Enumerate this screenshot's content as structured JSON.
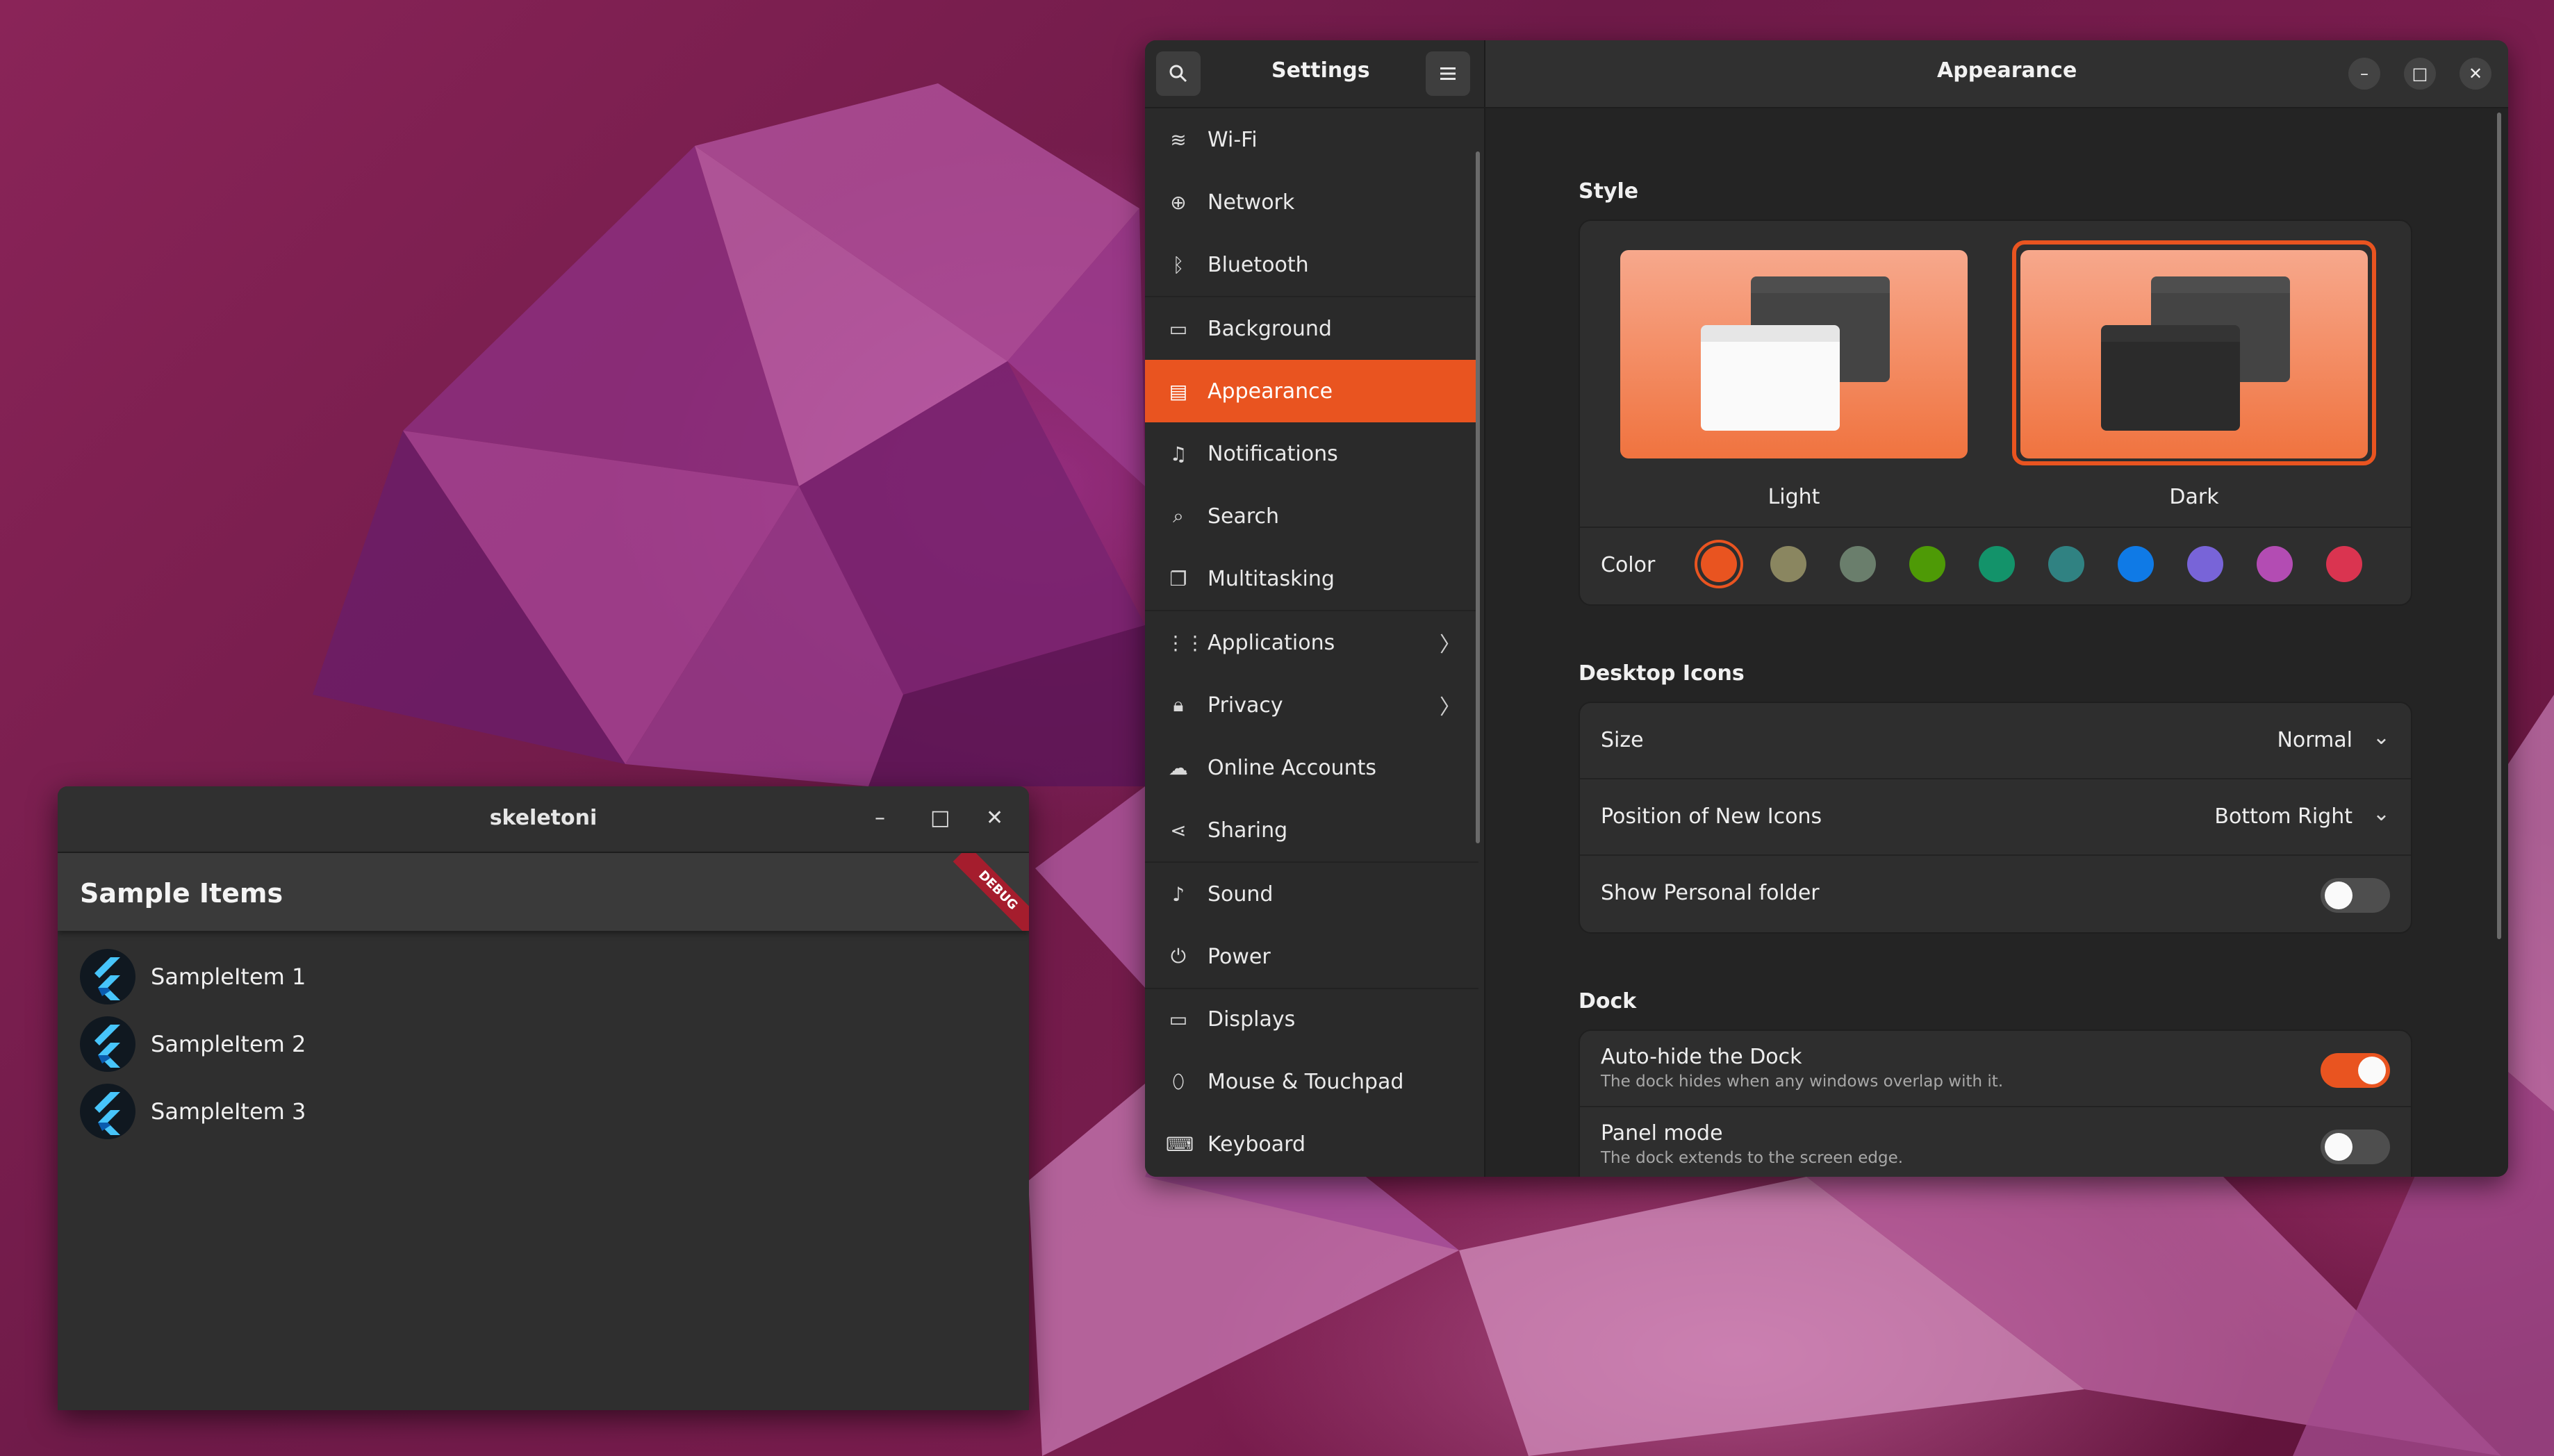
{
  "settings": {
    "header": {
      "app_title": "Settings",
      "page_title": "Appearance",
      "search_icon": "search-icon",
      "menu_icon": "hamburger-menu-icon",
      "minimize": "–",
      "maximize": "□",
      "close": "✕"
    },
    "sidebar": {
      "items": [
        {
          "label": "Wi-Fi",
          "icon": "wifi-icon",
          "glyph": "≋"
        },
        {
          "label": "Network",
          "icon": "network-icon",
          "glyph": "⊕"
        },
        {
          "label": "Bluetooth",
          "icon": "bluetooth-icon",
          "glyph": "ᛒ"
        },
        {
          "label": "Background",
          "icon": "background-icon",
          "glyph": "▭"
        },
        {
          "label": "Appearance",
          "icon": "appearance-icon",
          "glyph": "▤",
          "active": true
        },
        {
          "label": "Notifications",
          "icon": "bell-icon",
          "glyph": "♫"
        },
        {
          "label": "Search",
          "icon": "search-icon",
          "glyph": "⌕"
        },
        {
          "label": "Multitasking",
          "icon": "multitasking-icon",
          "glyph": "❐"
        },
        {
          "label": "Applications",
          "icon": "applications-icon",
          "glyph": "⋮⋮",
          "chevron": "〉"
        },
        {
          "label": "Privacy",
          "icon": "lock-icon",
          "glyph": "🔒︎",
          "chevron": "〉"
        },
        {
          "label": "Online Accounts",
          "icon": "cloud-icon",
          "glyph": "☁"
        },
        {
          "label": "Sharing",
          "icon": "share-icon",
          "glyph": "⋖"
        },
        {
          "label": "Sound",
          "icon": "music-note-icon",
          "glyph": "♪"
        },
        {
          "label": "Power",
          "icon": "power-icon",
          "glyph": "⏻"
        },
        {
          "label": "Displays",
          "icon": "display-icon",
          "glyph": "▭"
        },
        {
          "label": "Mouse & Touchpad",
          "icon": "mouse-icon",
          "glyph": "⬯"
        },
        {
          "label": "Keyboard",
          "icon": "keyboard-icon",
          "glyph": "⌨"
        }
      ]
    },
    "style": {
      "title": "Style",
      "light_label": "Light",
      "dark_label": "Dark",
      "selected": "Dark",
      "color_label": "Color",
      "colors": [
        "#e95420",
        "#8a8660",
        "#6a7e6c",
        "#4e9a06",
        "#13936a",
        "#308282",
        "#0f7ae6",
        "#7864d8",
        "#b34cb3",
        "#da3450"
      ],
      "selected_color": "#e95420"
    },
    "desktop_icons": {
      "title": "Desktop Icons",
      "size_label": "Size",
      "size_value": "Normal",
      "position_label": "Position of New Icons",
      "position_value": "Bottom Right",
      "personal_folder_label": "Show Personal folder",
      "personal_folder_on": false
    },
    "dock": {
      "title": "Dock",
      "autohide_label": "Auto-hide the Dock",
      "autohide_sub": "The dock hides when any windows overlap with it.",
      "autohide_on": true,
      "panel_label": "Panel mode",
      "panel_sub": "The dock extends to the screen edge.",
      "panel_on": false
    }
  },
  "skeleton": {
    "title": "skeletoni",
    "minimize": "–",
    "maximize": "□",
    "close": "✕",
    "appbar_title": "Sample Items",
    "debug_banner": "DEBUG",
    "items": [
      "SampleItem 1",
      "SampleItem 2",
      "SampleItem 3"
    ]
  }
}
